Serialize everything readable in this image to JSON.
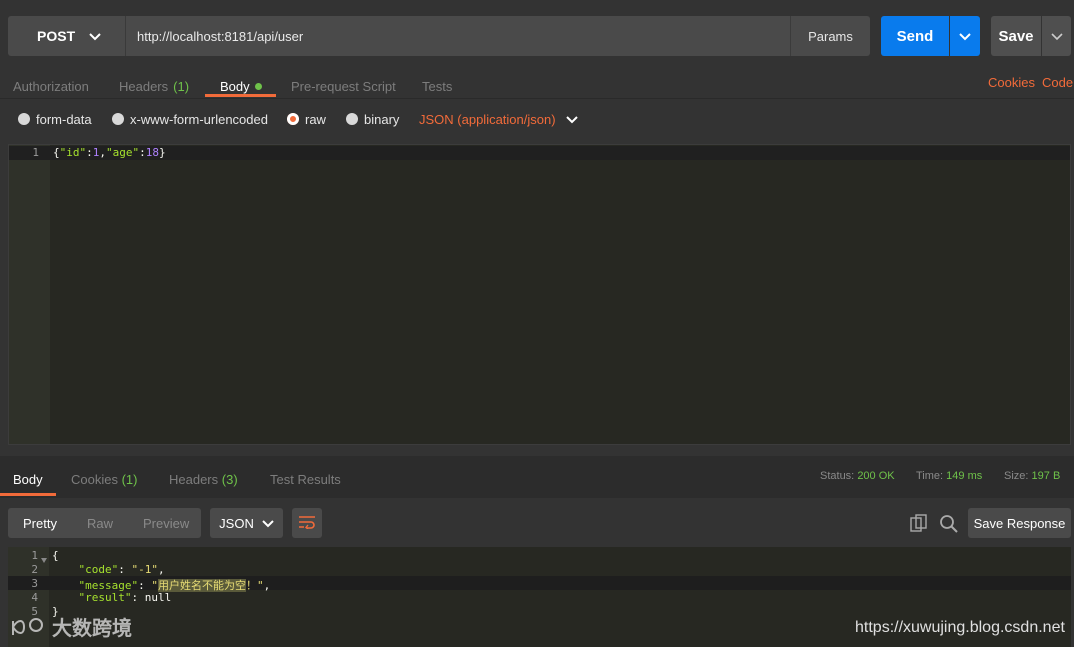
{
  "request": {
    "method": "POST",
    "url": "http://localhost:8181/api/user",
    "params_label": "Params",
    "send_label": "Send",
    "save_label": "Save"
  },
  "request_tabs": {
    "authorization": "Authorization",
    "headers": "Headers",
    "headers_count": "(1)",
    "body": "Body",
    "prerequest": "Pre-request Script",
    "tests": "Tests",
    "cookies": "Cookies",
    "code": "Code"
  },
  "body_types": {
    "form_data": "form-data",
    "urlencoded": "x-www-form-urlencoded",
    "raw": "raw",
    "binary": "binary",
    "content_type": "JSON (application/json)"
  },
  "request_body": {
    "line_number": "1",
    "open": "{",
    "key1": "\"id\"",
    "colon1": ":",
    "val1": "1",
    "comma": ",",
    "key2": "\"age\"",
    "colon2": ":",
    "val2": "18",
    "close": "}"
  },
  "response_tabs": {
    "body": "Body",
    "cookies": "Cookies",
    "cookies_count": "(1)",
    "headers": "Headers",
    "headers_count": "(3)",
    "test_results": "Test Results"
  },
  "status": {
    "status_label": "Status:",
    "status_value": "200 OK",
    "time_label": "Time:",
    "time_value": "149 ms",
    "size_label": "Size:",
    "size_value": "197 B"
  },
  "response_toolbar": {
    "pretty": "Pretty",
    "raw": "Raw",
    "preview": "Preview",
    "format": "JSON",
    "save_response": "Save Response"
  },
  "response_body": {
    "lines": [
      "1",
      "2",
      "3",
      "4",
      "5"
    ],
    "open": "{",
    "code_key": "\"code\"",
    "code_val": "\"-1\"",
    "message_key": "\"message\"",
    "message_q": "\"",
    "message_cjk": "用户姓名不能为空",
    "message_tail": "！\"",
    "result_key": "\"result\"",
    "result_val": "null",
    "close": "}"
  },
  "watermark": {
    "left": "大数跨境",
    "right": "https://xuwujing.blog.csdn.net"
  },
  "colors": {
    "accent": "#f26b3a",
    "send_blue": "#097bed",
    "count_green": "#6fc24a"
  }
}
